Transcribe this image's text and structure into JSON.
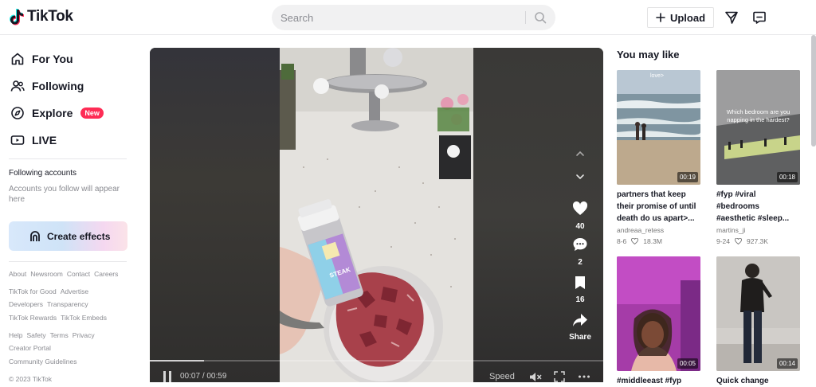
{
  "app": {
    "name": "TikTok"
  },
  "search": {
    "placeholder": "Search"
  },
  "header": {
    "upload_label": "Upload"
  },
  "sidebar": {
    "items": [
      {
        "label": "For You",
        "icon": "home-icon"
      },
      {
        "label": "Following",
        "icon": "users-icon"
      },
      {
        "label": "Explore",
        "icon": "compass-icon",
        "badge": "New"
      },
      {
        "label": "LIVE",
        "icon": "live-icon"
      }
    ],
    "following_title": "Following accounts",
    "following_empty": "Accounts you follow will appear here",
    "effects_label": "Create effects",
    "footer": [
      [
        "About",
        "Newsroom",
        "Contact",
        "Careers"
      ],
      [
        "TikTok for Good",
        "Advertise"
      ],
      [
        "Developers",
        "Transparency"
      ],
      [
        "TikTok Rewards",
        "TikTok Embeds"
      ],
      [
        "Help",
        "Safety",
        "Terms",
        "Privacy"
      ],
      [
        "Creator Portal"
      ],
      [
        "Community Guidelines"
      ],
      [
        "© 2023 TikTok"
      ]
    ]
  },
  "player": {
    "current_time": "00:07",
    "duration": "00:59",
    "progress": 0.12,
    "speed_label": "Speed",
    "likes": "40",
    "comments": "2",
    "saves": "16",
    "share_label": "Share",
    "product_label": "STEAK"
  },
  "rail": {
    "title": "You may like",
    "cards": [
      {
        "duration": "00:19",
        "overlay": "love>",
        "title": "partners that keep their promise of until death do us apart>...",
        "author": "andreaa_retess",
        "date": "8-6",
        "likes": "18.3M"
      },
      {
        "duration": "00:18",
        "overlay": "Which bedroom are you napping in the hardest?",
        "title": "#fyp #viral #bedrooms #aesthetic #sleep...",
        "author": "martins_ji",
        "date": "9-24",
        "likes": "927.3K"
      },
      {
        "duration": "00:05",
        "overlay": "",
        "title": "#middleeast #fyp",
        "author": "",
        "date": "",
        "likes": ""
      },
      {
        "duration": "00:14",
        "overlay": "",
        "title": "Quick change",
        "author": "",
        "date": "",
        "likes": ""
      }
    ]
  },
  "colors": {
    "accent": "#fe2c55",
    "text": "#161823",
    "muted": "#8a8b91"
  }
}
